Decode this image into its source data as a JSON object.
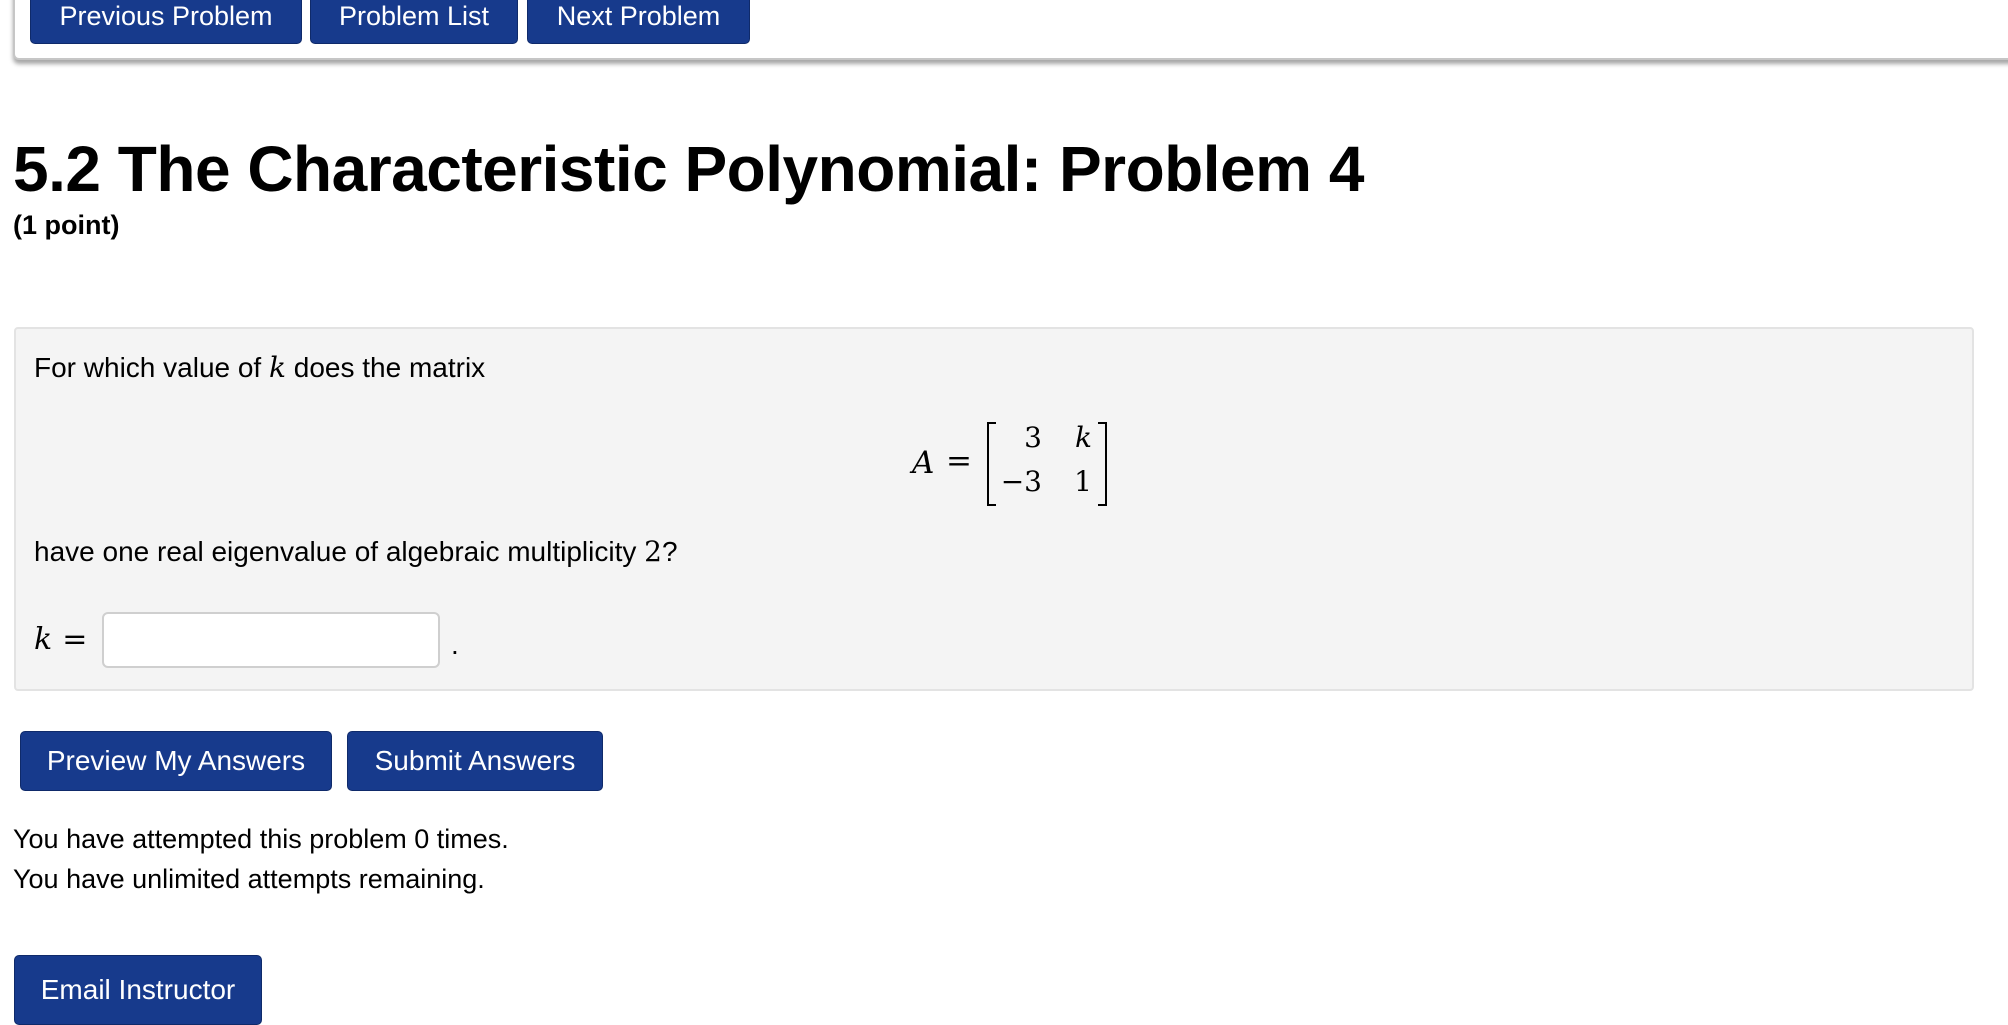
{
  "nav": {
    "previous_label": "Previous Problem",
    "list_label": "Problem List",
    "next_label": "Next Problem"
  },
  "problem": {
    "title": "5.2 The Characteristic Polynomial: Problem 4",
    "points": "(1 point)",
    "prompt_before": "For which value of ",
    "variable": "k",
    "prompt_after": " does the matrix",
    "matrix_name": "A",
    "equals": "=",
    "matrix": [
      [
        "3",
        "k"
      ],
      [
        "−3",
        "1"
      ]
    ],
    "question_before": "have one real eigenvalue of algebraic multiplicity ",
    "multiplicity": "2",
    "question_after": "?",
    "answer_label_var": "k",
    "answer_value": "",
    "answer_suffix": "."
  },
  "actions": {
    "preview_label": "Preview My Answers",
    "submit_label": "Submit Answers",
    "email_label": "Email Instructor"
  },
  "status": {
    "attempts": "You have attempted this problem 0 times.",
    "remaining": "You have unlimited attempts remaining."
  },
  "colors": {
    "button_bg": "#173a8c",
    "problem_bg": "#f4f4f4"
  }
}
